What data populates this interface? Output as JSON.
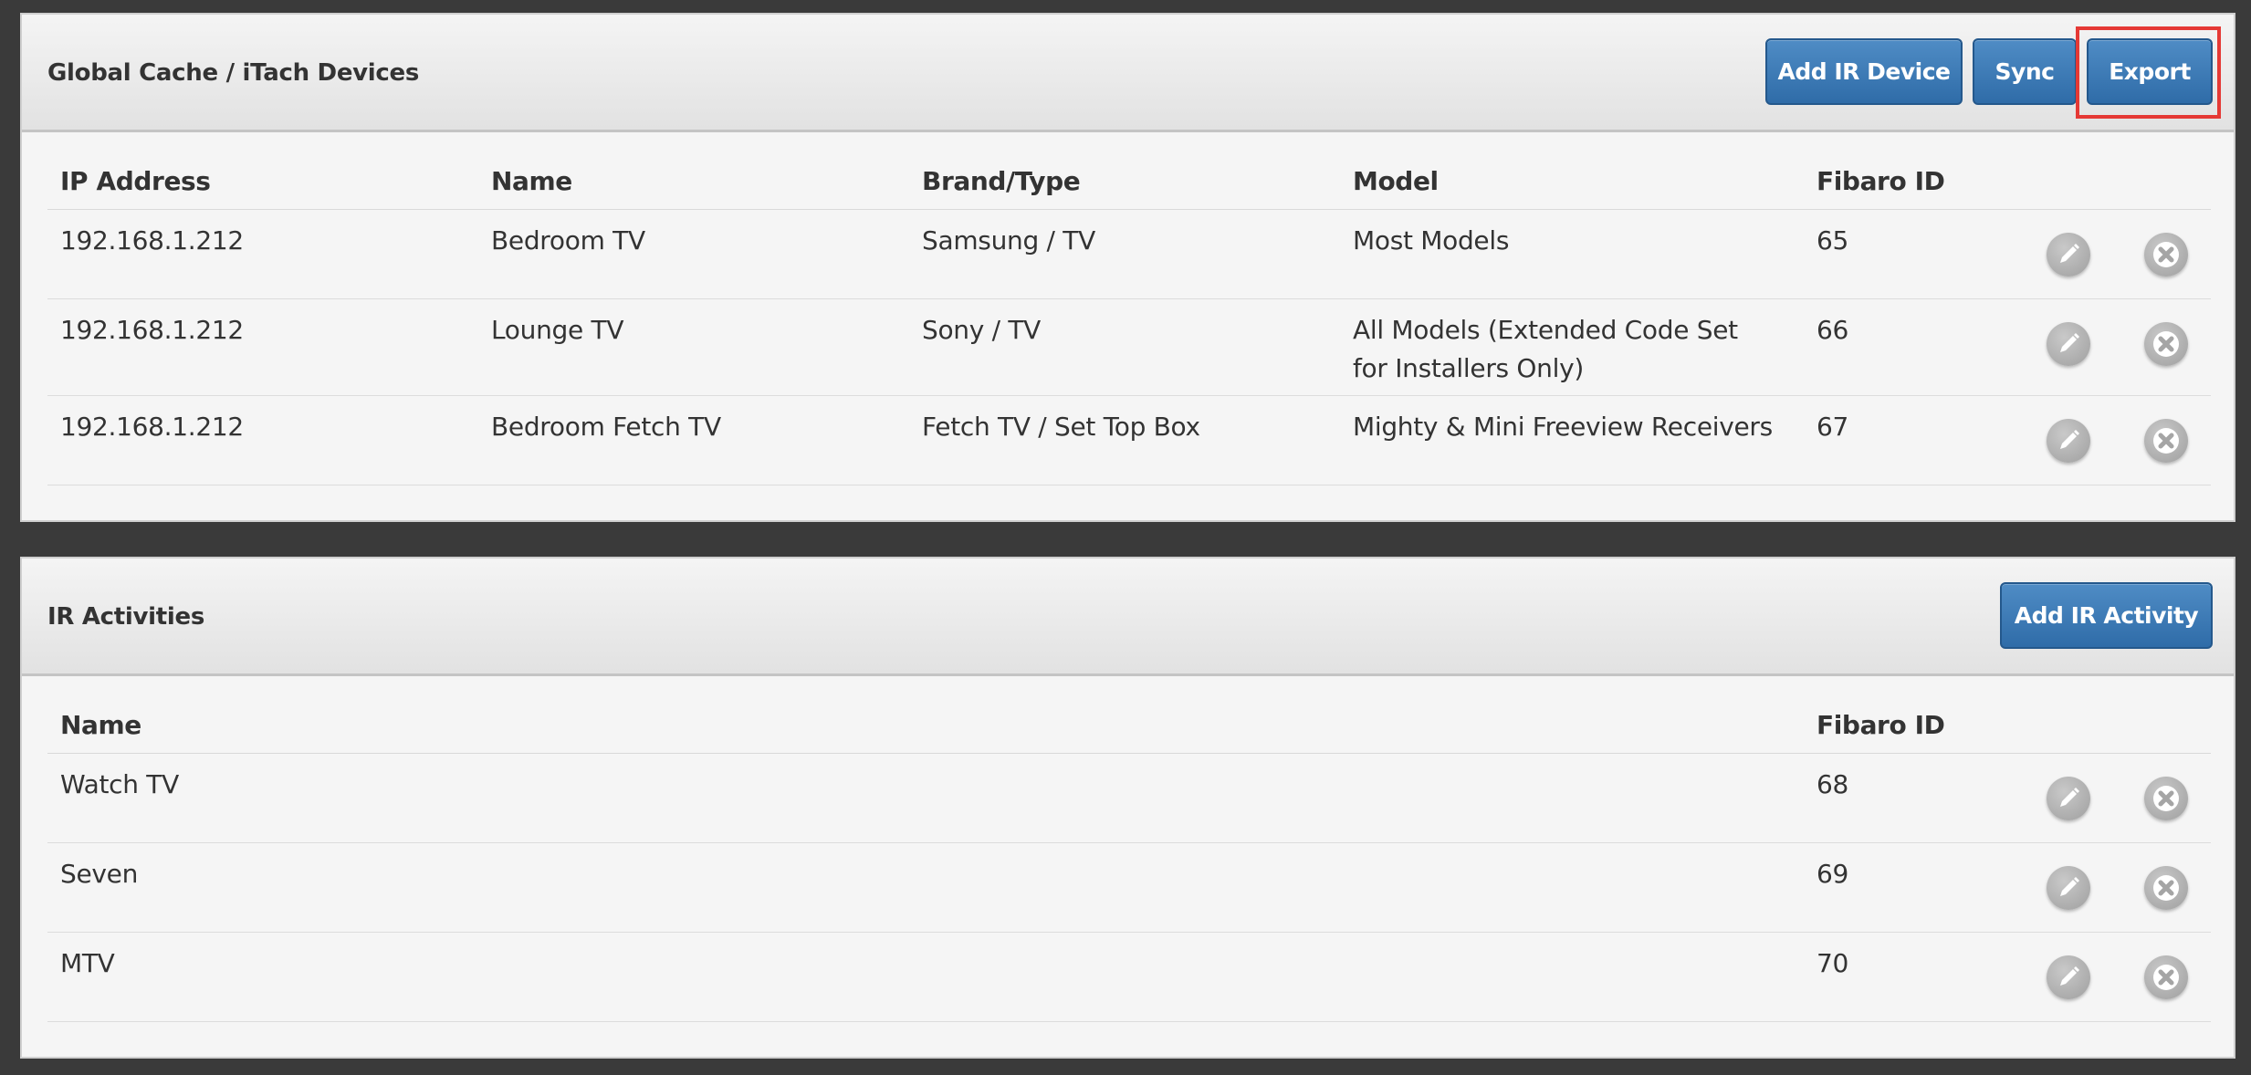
{
  "devices_panel": {
    "title": "Global Cache / iTach Devices",
    "buttons": {
      "add": "Add IR Device",
      "sync": "Sync",
      "export": "Export"
    },
    "columns": [
      "IP Address",
      "Name",
      "Brand/Type",
      "Model",
      "Fibaro ID"
    ],
    "rows": [
      {
        "ip": "192.168.1.212",
        "name": "Bedroom TV",
        "brand": "Samsung / TV",
        "model": "Most Models",
        "fibaro_id": "65"
      },
      {
        "ip": "192.168.1.212",
        "name": "Lounge TV",
        "brand": "Sony / TV",
        "model": "All Models (Extended Code Set for Installers Only)",
        "fibaro_id": "66"
      },
      {
        "ip": "192.168.1.212",
        "name": "Bedroom Fetch TV",
        "brand": "Fetch TV / Set Top Box",
        "model": "Mighty & Mini Freeview Receivers",
        "fibaro_id": "67"
      }
    ]
  },
  "activities_panel": {
    "title": "IR Activities",
    "buttons": {
      "add": "Add IR Activity"
    },
    "columns": [
      "Name",
      "Fibaro ID"
    ],
    "rows": [
      {
        "name": "Watch TV",
        "fibaro_id": "68"
      },
      {
        "name": "Seven",
        "fibaro_id": "69"
      },
      {
        "name": "MTV",
        "fibaro_id": "70"
      }
    ]
  },
  "icons": {
    "edit": "pencil-icon",
    "delete": "close-icon"
  },
  "colors": {
    "button_primary": "#3b78b5",
    "highlight": "#e53935",
    "background": "#3a3a3a"
  }
}
